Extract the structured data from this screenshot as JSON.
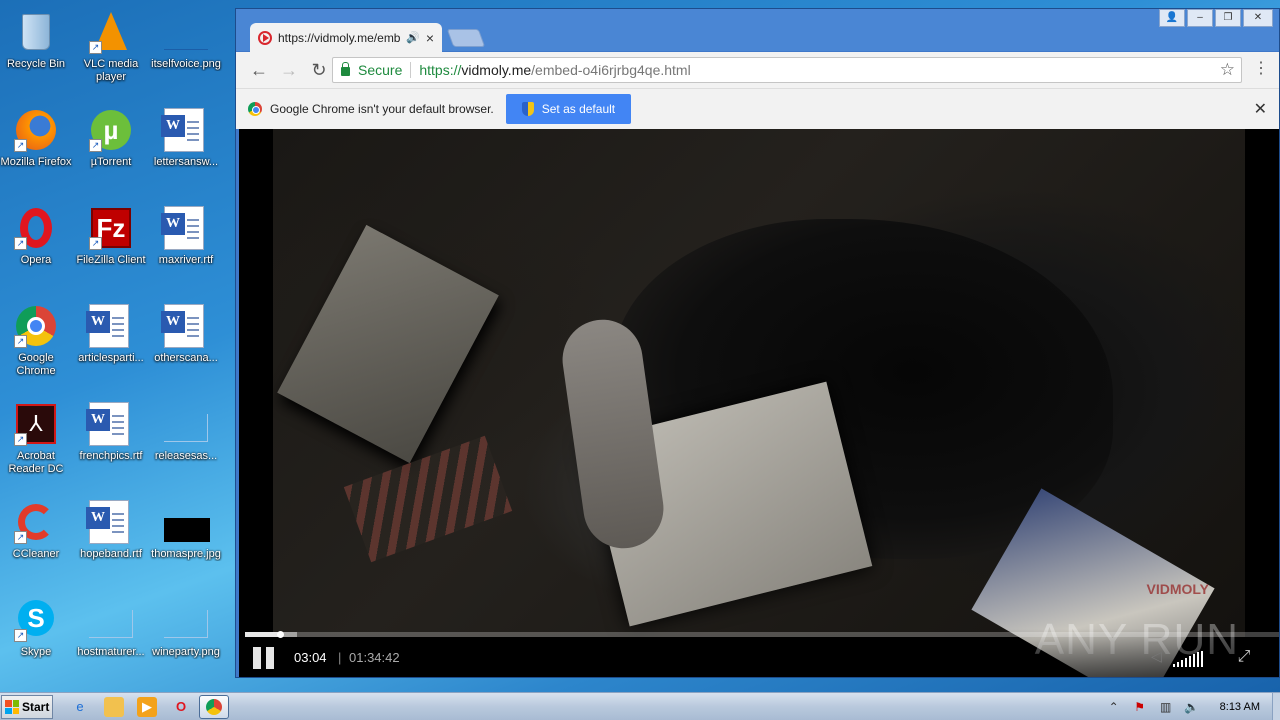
{
  "desktop": {
    "icons": [
      {
        "label": "Recycle Bin",
        "icon": "recycle-bin-icon"
      },
      {
        "label": "VLC media player",
        "icon": "vlc-icon"
      },
      {
        "label": "itselfvoice.png",
        "icon": "png-file-icon"
      },
      {
        "label": "Mozilla Firefox",
        "icon": "firefox-icon"
      },
      {
        "label": "µTorrent",
        "icon": "utorrent-icon"
      },
      {
        "label": "lettersansw...",
        "icon": "word-doc-icon"
      },
      {
        "label": "Opera",
        "icon": "opera-icon"
      },
      {
        "label": "FileZilla Client",
        "icon": "filezilla-icon"
      },
      {
        "label": "maxriver.rtf",
        "icon": "word-doc-icon"
      },
      {
        "label": "Google Chrome",
        "icon": "chrome-icon"
      },
      {
        "label": "articlesparti...",
        "icon": "word-doc-icon"
      },
      {
        "label": "otherscana...",
        "icon": "word-doc-icon"
      },
      {
        "label": "Acrobat Reader DC",
        "icon": "acrobat-icon"
      },
      {
        "label": "frenchpics.rtf",
        "icon": "word-doc-icon"
      },
      {
        "label": "releasesas...",
        "icon": "blank-file-icon"
      },
      {
        "label": "CCleaner",
        "icon": "ccleaner-icon"
      },
      {
        "label": "hopeband.rtf",
        "icon": "word-doc-icon"
      },
      {
        "label": "thomaspre.jpg",
        "icon": "jpg-file-icon"
      },
      {
        "label": "Skype",
        "icon": "skype-icon"
      },
      {
        "label": "hostmaturer...",
        "icon": "blank-file-icon"
      },
      {
        "label": "wineparty.png",
        "icon": "png-file-icon"
      }
    ]
  },
  "browser": {
    "tab_title": "https://vidmoly.me/emb",
    "address": {
      "secure_label": "Secure",
      "scheme": "https://",
      "host": "vidmoly.me",
      "path": "/embed-o4i6rjrbg4qe.html"
    },
    "infobar": {
      "message": "Google Chrome isn't your default browser.",
      "button_label": "Set as default"
    }
  },
  "player": {
    "current_time": "03:04",
    "separator": "|",
    "duration": "01:34:42",
    "progress_fraction": 0.034,
    "buffered_fraction": 0.05,
    "brand_watermark": "VIDMOLY",
    "overlay_watermark": "ANY RUN"
  },
  "taskbar": {
    "start_label": "Start",
    "clock": "8:13 AM"
  },
  "colors": {
    "accent": "#4285f4",
    "secure_green": "#1e8a3e"
  }
}
